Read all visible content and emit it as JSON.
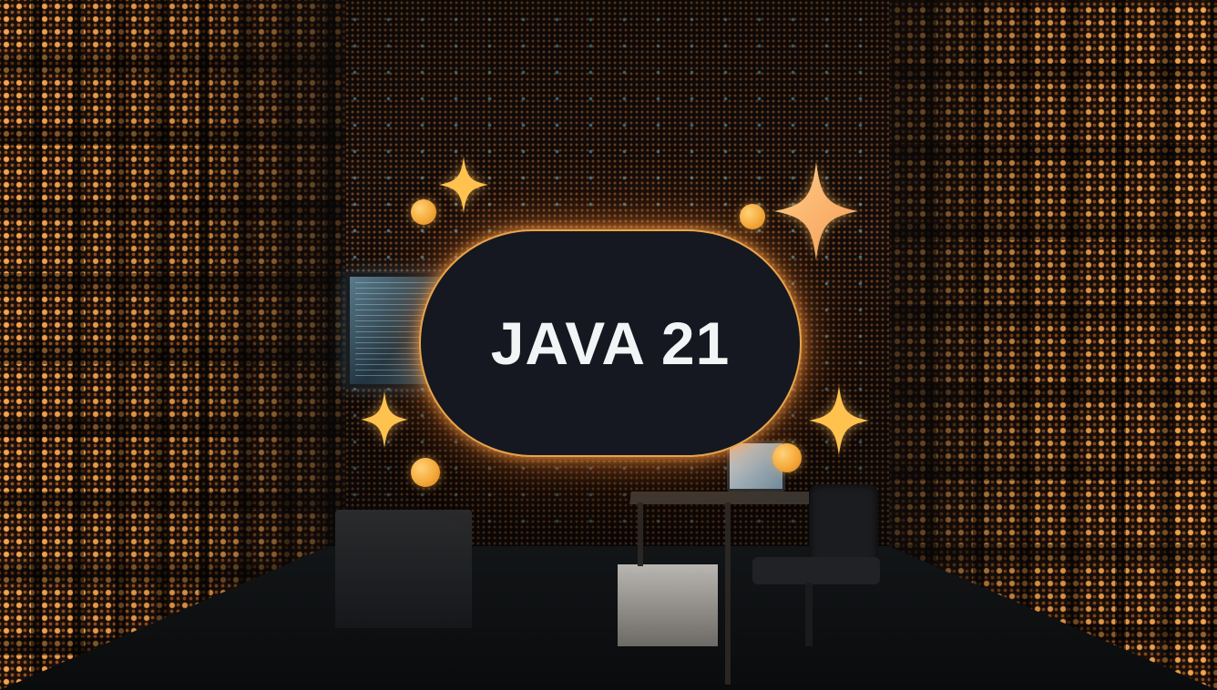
{
  "badge": {
    "label": "JAVA 21"
  },
  "colors": {
    "badge_background": "#151820",
    "badge_border": "#e8a44c",
    "badge_text": "#f3f4f6",
    "sparkle": "#ffc24f",
    "orb": "#f5a93a",
    "led_glow": "#ff9a3c"
  },
  "decorations": {
    "sparkle_icon": "four-point-star-icon",
    "orb_icon": "glowing-orb-icon"
  }
}
